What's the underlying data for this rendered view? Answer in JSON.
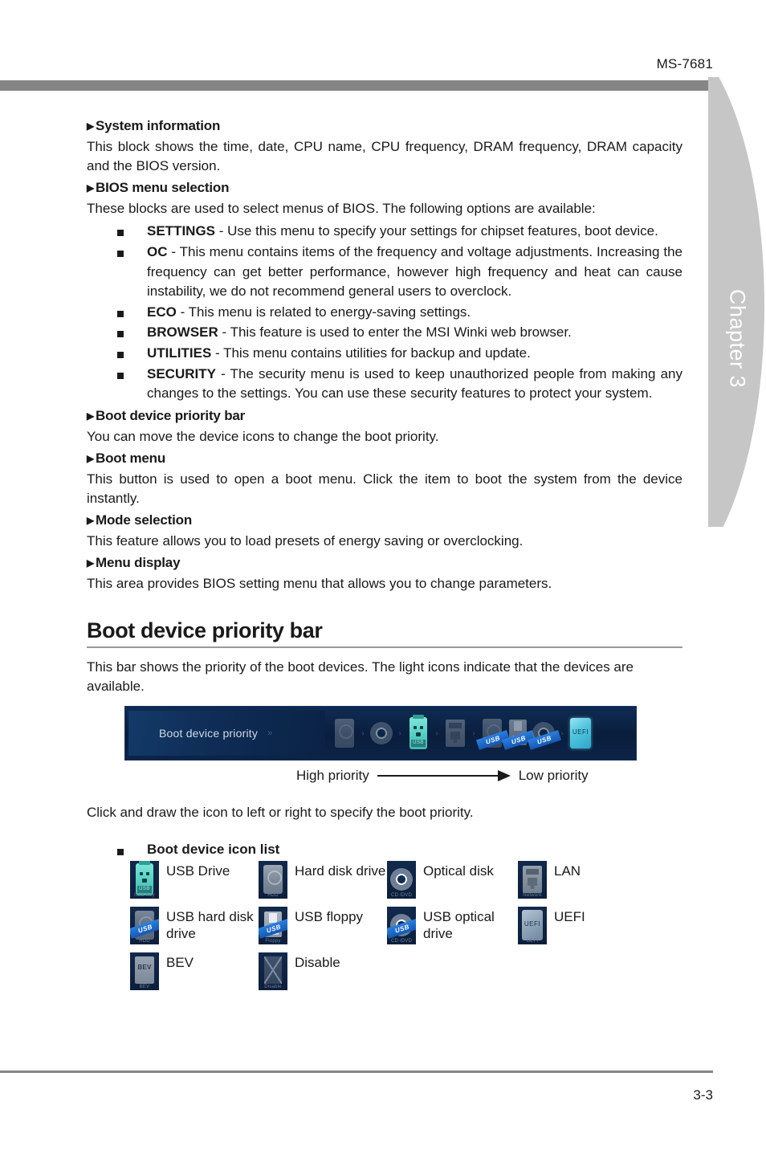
{
  "page": {
    "model": "MS-7681",
    "chapter_tab": "Chapter 3",
    "page_number": "3-3"
  },
  "sections": [
    {
      "heading": "System information",
      "body": "This block shows the time, date, CPU name, CPU frequency, DRAM frequency, DRAM capacity and the BIOS version."
    },
    {
      "heading": "BIOS menu selection",
      "body": "These blocks are used to select menus of BIOS. The following options are available:"
    },
    {
      "heading": "Boot device priority bar",
      "body": "You can move the device icons to change the boot priority."
    },
    {
      "heading": "Boot menu",
      "body": "This button is used to open a boot menu. Click the item to boot the system from the device instantly."
    },
    {
      "heading": "Mode selection",
      "body": "This feature allows you to load presets of energy saving or overclocking."
    },
    {
      "heading": "Menu display",
      "body": "This area provides BIOS setting menu that allows you to change parameters."
    }
  ],
  "menu_options": [
    {
      "name": "SETTINGS",
      "desc": " - Use this menu to specify your settings for chipset features, boot device."
    },
    {
      "name": "OC",
      "desc": " - This menu contains items of the frequency and voltage adjustments. Increasing the frequency can get better performance, however high frequency and heat can cause instability, we do not recommend general users to overclock."
    },
    {
      "name": "ECO",
      "desc": " - This menu is related to energy-saving settings."
    },
    {
      "name": "BROWSER",
      "desc": " - This feature is used to enter the MSI Winki web browser."
    },
    {
      "name": "UTILITIES",
      "desc": " - This menu contains utilities for backup and update."
    },
    {
      "name": "SECURITY",
      "desc": " - The security menu is used to keep unauthorized people from making any changes to the settings. You can use these security features to protect your system."
    }
  ],
  "boot_section": {
    "title": "Boot device priority bar",
    "intro": "This bar shows the priority of the boot devices. The light icons indicate that the devices are available.",
    "bar_label": "Boot device priority",
    "bar_chevrons": "››",
    "legend_high": "High priority",
    "legend_low": "Low priority",
    "click_note": "Click and draw the icon to left or right to specify the boot priority.",
    "bar_icons": [
      {
        "icon": "hard-disk-drive-icon",
        "state": "dim"
      },
      {
        "icon": "optical-disk-icon",
        "state": "dim"
      },
      {
        "icon": "usb-drive-icon",
        "state": "lit"
      },
      {
        "icon": "lan-icon",
        "state": "dim"
      },
      {
        "icon": "usb-hard-disk-drive-icon",
        "state": "dim"
      },
      {
        "icon": "usb-floppy-icon",
        "state": "dim"
      },
      {
        "icon": "usb-optical-drive-icon",
        "state": "dim"
      },
      {
        "icon": "uefi-icon",
        "state": "lit"
      }
    ]
  },
  "icon_list": {
    "heading": "Boot device icon list",
    "items": [
      {
        "label": "USB Drive",
        "caption": "USB Key",
        "sash": "",
        "icon": "usb-drive-icon"
      },
      {
        "label": "Hard disk drive",
        "caption": "HDD",
        "sash": "",
        "icon": "hard-disk-drive-icon"
      },
      {
        "label": "Optical disk",
        "caption": "CD /DVD",
        "sash": "",
        "icon": "optical-disk-icon"
      },
      {
        "label": "LAN",
        "caption": "Network",
        "sash": "",
        "icon": "lan-icon"
      },
      {
        "label": "USB hard disk drive",
        "caption": "HDD",
        "sash": "USB",
        "icon": "usb-hard-disk-drive-icon"
      },
      {
        "label": "USB floppy",
        "caption": "Floppy",
        "sash": "USB",
        "icon": "usb-floppy-icon"
      },
      {
        "label": "USB optical drive",
        "caption": "CD /DVD",
        "sash": "USB",
        "icon": "usb-optical-drive-icon"
      },
      {
        "label": "UEFI",
        "caption": "UEFI",
        "sash": "",
        "icon": "uefi-icon",
        "badge": "UEFI"
      },
      {
        "label": "BEV",
        "caption": "BEV",
        "sash": "",
        "icon": "bev-icon",
        "badge": "BEV"
      },
      {
        "label": "Disable",
        "caption": "Disable",
        "sash": "",
        "icon": "disable-icon"
      }
    ]
  },
  "colors": {
    "rule_gray": "#858585",
    "tab_gray": "#c6c6c6",
    "bios_navy": "#0c1f3c",
    "usb_sash_blue": "#1558b4",
    "lit_teal": "#55cfc2"
  }
}
